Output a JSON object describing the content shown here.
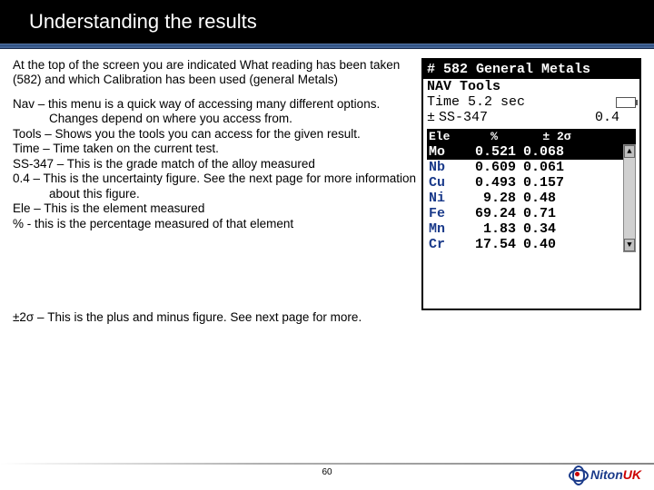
{
  "title": "Understanding the results",
  "intro": "At the top of the screen you are indicated What reading has been taken (582) and which Calibration has been used (general Metals)",
  "defs": [
    "Nav – this menu is a quick way of accessing many different options. Changes depend on where you access from.",
    "Tools – Shows you the tools you can access for the given result.",
    "Time – Time taken on the current test.",
    "SS-347 – This is the grade match of the alloy measured",
    "0.4 – This is the uncertainty figure. See the next page for more information about this figure.",
    "Ele – This is the element measured",
    "% - this is the percentage measured of that element"
  ],
  "defLast": "±2σ – This is the plus and minus figure. See next page for more.",
  "device": {
    "header": "# 582 General Metals",
    "nav": "NAV Tools",
    "time": "Time 5.2 sec",
    "alloy_prefix": "±",
    "alloy": "SS-347",
    "alloy_val": "0.4",
    "cols": {
      "c1": "Ele",
      "c2": "%",
      "c3": "± 2σ"
    },
    "rows": [
      {
        "el": "Mo",
        "pct": "0.521",
        "sig": "0.068",
        "hi": true
      },
      {
        "el": "Nb",
        "pct": "0.609",
        "sig": "0.061"
      },
      {
        "el": "Cu",
        "pct": "0.493",
        "sig": "0.157"
      },
      {
        "el": "Ni",
        "pct": "9.28",
        "sig": "0.48"
      },
      {
        "el": "Fe",
        "pct": "69.24",
        "sig": "0.71"
      },
      {
        "el": "Mn",
        "pct": "1.83",
        "sig": "0.34"
      },
      {
        "el": "Cr",
        "pct": "17.54",
        "sig": "0.40"
      }
    ]
  },
  "pageNum": "60",
  "logo": {
    "a": "Niton",
    "b": "UK"
  }
}
